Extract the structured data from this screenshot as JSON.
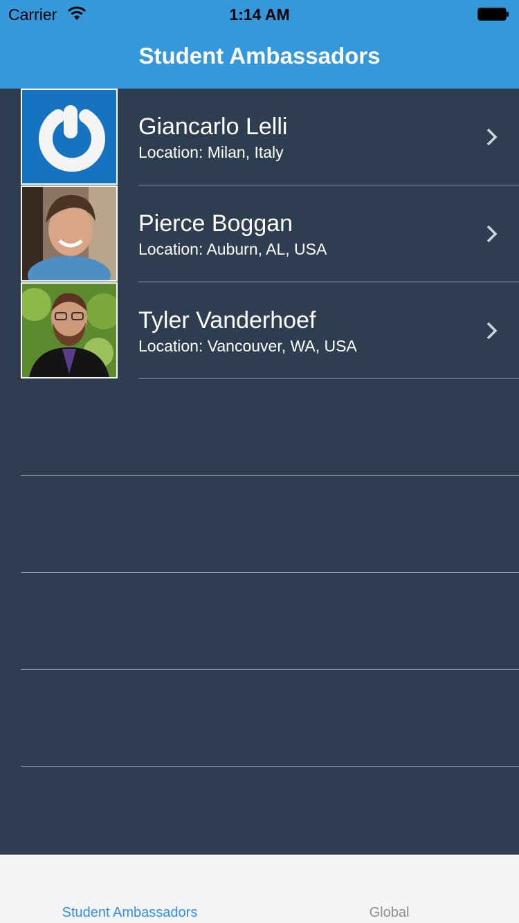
{
  "status_bar": {
    "carrier": "Carrier",
    "time": "1:14 AM"
  },
  "nav": {
    "title": "Student Ambassadors"
  },
  "colors": {
    "header": "#3498db",
    "background": "#2e3e50",
    "tab_active": "#2f8fe0",
    "tab_inactive": "#8e8e93"
  },
  "ambassadors": [
    {
      "name": "Giancarlo Lelli",
      "location": "Location: Milan, Italy",
      "avatar": "power-logo-icon"
    },
    {
      "name": "Pierce Boggan",
      "location": "Location: Auburn, AL, USA",
      "avatar": "person-photo"
    },
    {
      "name": "Tyler Vanderhoef",
      "location": "Location: Vancouver, WA, USA",
      "avatar": "person-photo"
    }
  ],
  "tabs": [
    {
      "label": "Student Ambassadors",
      "active": true
    },
    {
      "label": "Global",
      "active": false
    }
  ]
}
